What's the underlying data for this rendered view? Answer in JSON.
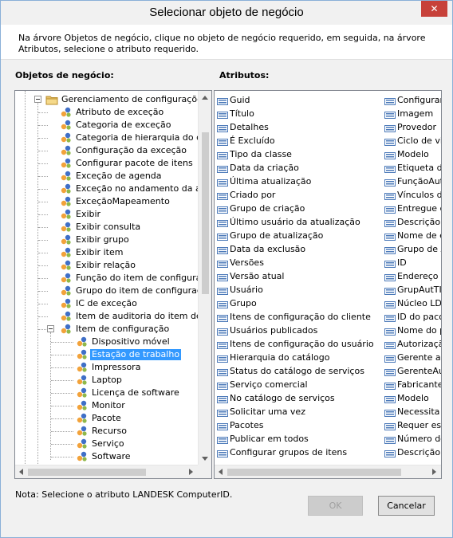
{
  "window": {
    "title": "Selecionar objeto de negócio",
    "close_glyph": "✕"
  },
  "instructions": "Na árvore Objetos de negócio, clique no objeto de negócio requerido, em seguida, na árvore Atributos, selecione o atributo requerido.",
  "labels": {
    "business_objects": "Objetos de negócio:",
    "attributes": "Atributos:"
  },
  "tree": {
    "root": {
      "label": "Gerenciamento de configurações",
      "icon": "folder-icon"
    },
    "items": [
      {
        "label": "Atributo de exceção"
      },
      {
        "label": "Categoria de exceção"
      },
      {
        "label": "Categoria de hierarquia do catá"
      },
      {
        "label": "Configuração da exceção"
      },
      {
        "label": "Configurar pacote de itens"
      },
      {
        "label": "Exceção de agenda"
      },
      {
        "label": "Exceção no andamento da agen"
      },
      {
        "label": "ExceçãoMapeamento"
      },
      {
        "label": "Exibir"
      },
      {
        "label": "Exibir consulta"
      },
      {
        "label": "Exibir grupo"
      },
      {
        "label": "Exibir item"
      },
      {
        "label": "Exibir relação"
      },
      {
        "label": "Função do item de configuração"
      },
      {
        "label": "Grupo do item de configuração"
      },
      {
        "label": "IC de exceção"
      },
      {
        "label": "Item de auditoria do item de co"
      },
      {
        "label": "Item de configuração"
      }
    ],
    "children": [
      {
        "label": "Dispositivo móvel"
      },
      {
        "label": "Estação de trabalho",
        "selected": true
      },
      {
        "label": "Impressora"
      },
      {
        "label": "Laptop"
      },
      {
        "label": "Licença de software"
      },
      {
        "label": "Monitor"
      },
      {
        "label": "Pacote"
      },
      {
        "label": "Recurso"
      },
      {
        "label": "Serviço"
      },
      {
        "label": "Software"
      }
    ]
  },
  "attributes": {
    "col1": [
      "Guid",
      "Título",
      "Detalhes",
      "É Excluído",
      "Tipo da classe",
      "Data da criação",
      "Última atualização",
      "Criado por",
      "Grupo de criação",
      "Último usuário da atualização",
      "Grupo de atualização",
      "Data da exclusão",
      "Versões",
      "Versão atual",
      "Usuário",
      "Grupo",
      "Itens de configuração do cliente",
      "Usuários publicados",
      "Itens de configuração do usuário",
      "Hierarquia do catálogo",
      "Status do catálogo de serviços",
      "Serviço comercial",
      "No catálogo de serviços",
      "Solicitar uma vez",
      "Pacotes",
      "Publicar em todos",
      "Configurar grupos de itens"
    ],
    "col2": [
      "Configurar",
      "Imagem",
      "Provedor",
      "Ciclo de vida",
      "Modelo",
      "Etiqueta de",
      "FunçãoAutCI",
      "Vínculos de",
      "Entregue co",
      "Descrição",
      "Nome de ex",
      "Grupo de Ac",
      "ID",
      "Endereço IP",
      "GrupAutTI",
      "Núcleo LDM",
      "ID do pacot",
      "Nome do pa",
      "Autorização",
      "Gerente aut",
      "GerenteAut",
      "Fabricante",
      "Modelo",
      "Necessita c",
      "Requer esto",
      "Número de",
      "Descrição d"
    ]
  },
  "note": "Nota: Selecione o atributo LANDESK ComputerID.",
  "buttons": {
    "ok": "OK",
    "cancel": "Cancelar"
  },
  "colors": {
    "selection": "#3399ff",
    "close_button": "#c7413a",
    "leaf_icon_blue": "#3f6fc7",
    "leaf_icon_orange": "#f2a23a"
  }
}
